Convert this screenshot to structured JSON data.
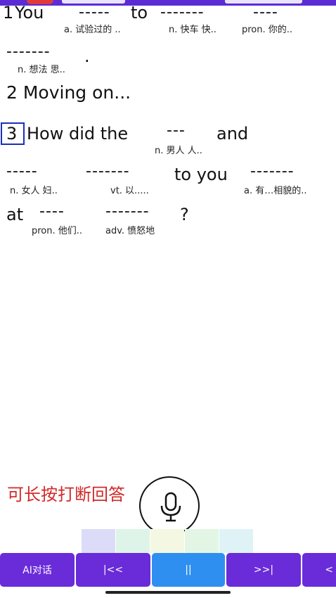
{
  "line1": {
    "number": "1",
    "you": "You",
    "blank1": "-----",
    "to": "to",
    "blank2": "-------",
    "blank3": "----"
  },
  "gloss1": [
    "a. 试验过的 ..",
    "n. 快车  快..",
    "pron. 你的.."
  ],
  "line2": {
    "blank": "-------",
    "period": "."
  },
  "gloss2": "n. 想法  思..",
  "section2": "2 Moving on...",
  "line3": {
    "number": "3",
    "how": "How did the",
    "blank": "---",
    "and": "and"
  },
  "gloss3": "n. 男人  人..",
  "line4": {
    "blank1": "-----",
    "blank2": "-------",
    "to_you": "to you",
    "blank3": "-------"
  },
  "gloss4": [
    "n. 女人  妇..",
    "vt. 以.....",
    "a. 有…相貌的.."
  ],
  "line5": {
    "at": "at",
    "blank1": "----",
    "blank2": "-------",
    "question": "?"
  },
  "gloss5": [
    "pron. 他们..",
    "adv. 愤怒地"
  ],
  "hint": "可长按打断回答",
  "toolbar": {
    "ai": "AI对话",
    "prev": "|<<",
    "pause": "||",
    "next": ">>|",
    "more": "<"
  },
  "colors": {
    "toolbar": "#6a2bd9",
    "active": "#2e8ff0",
    "hint": "#d12a2a",
    "highlight": "#1b2fb8"
  },
  "icons": [
    "microphone-icon"
  ]
}
